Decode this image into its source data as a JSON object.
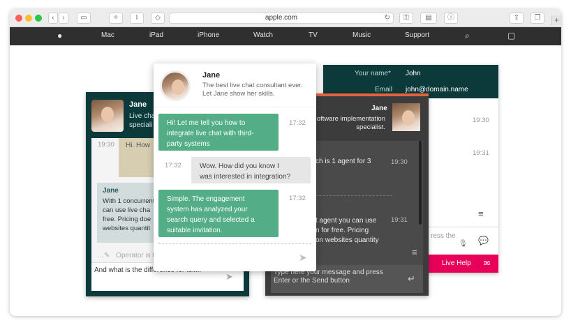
{
  "browser": {
    "url": "apple.com",
    "nav": [
      "Mac",
      "iPad",
      "iPhone",
      "Watch",
      "TV",
      "Music",
      "Support"
    ]
  },
  "left_widget": {
    "agent_name": "Jane",
    "agent_desc": "Live chat\nspeciali",
    "msg_time": "19:30",
    "msg_text": "Hi. How",
    "reply_name": "Jane",
    "reply_text": "With 1 concurrent\ncan use live cha\nfree. Pricing doe\nwebsites quantit",
    "typing_placeholder": "Operator is typ",
    "input_text": "And what is the difference for toll..."
  },
  "right_back_widget": {
    "name_label": "Your name*",
    "name_value": "John",
    "email_label": "Email",
    "email_value": "john@domain.name",
    "time1": "19:30",
    "time2": "19:31",
    "press_text": "ress the",
    "live_help": "Live Help"
  },
  "mid_back_widget": {
    "agent_name": "Jane",
    "agent_desc": "oftware implementation\nspecialist.",
    "msg1": "ch is 1 agent for 3",
    "time1": "19:30",
    "msg2": "t agent you can use\nn for free. Pricing\non websites quantity",
    "time2": "19:31",
    "input_placeholder": "Type here your message and press\nEnter or the Send button"
  },
  "main_chat": {
    "agent_name": "Jane",
    "agent_desc": "The best live chat consultant ever.\nLet Jane show her skills.",
    "messages": [
      {
        "from": "agent",
        "text": "Hi! Let me tell you how to\nintegrate live chat with third-\nparty systems",
        "time": "17:32"
      },
      {
        "from": "user",
        "text": "Wow. How did you know I\nwas interested in integration?",
        "time": "17:32"
      },
      {
        "from": "agent",
        "text": "Simple. The engagement\nsystem has analyzed your\nsearch query and selected a\nsuitable invitation.",
        "time": "17:32"
      }
    ]
  },
  "colors": {
    "green": "#53ad87",
    "teal": "#0c3a3b",
    "pink": "#e7005a",
    "orange": "#e2623e"
  }
}
